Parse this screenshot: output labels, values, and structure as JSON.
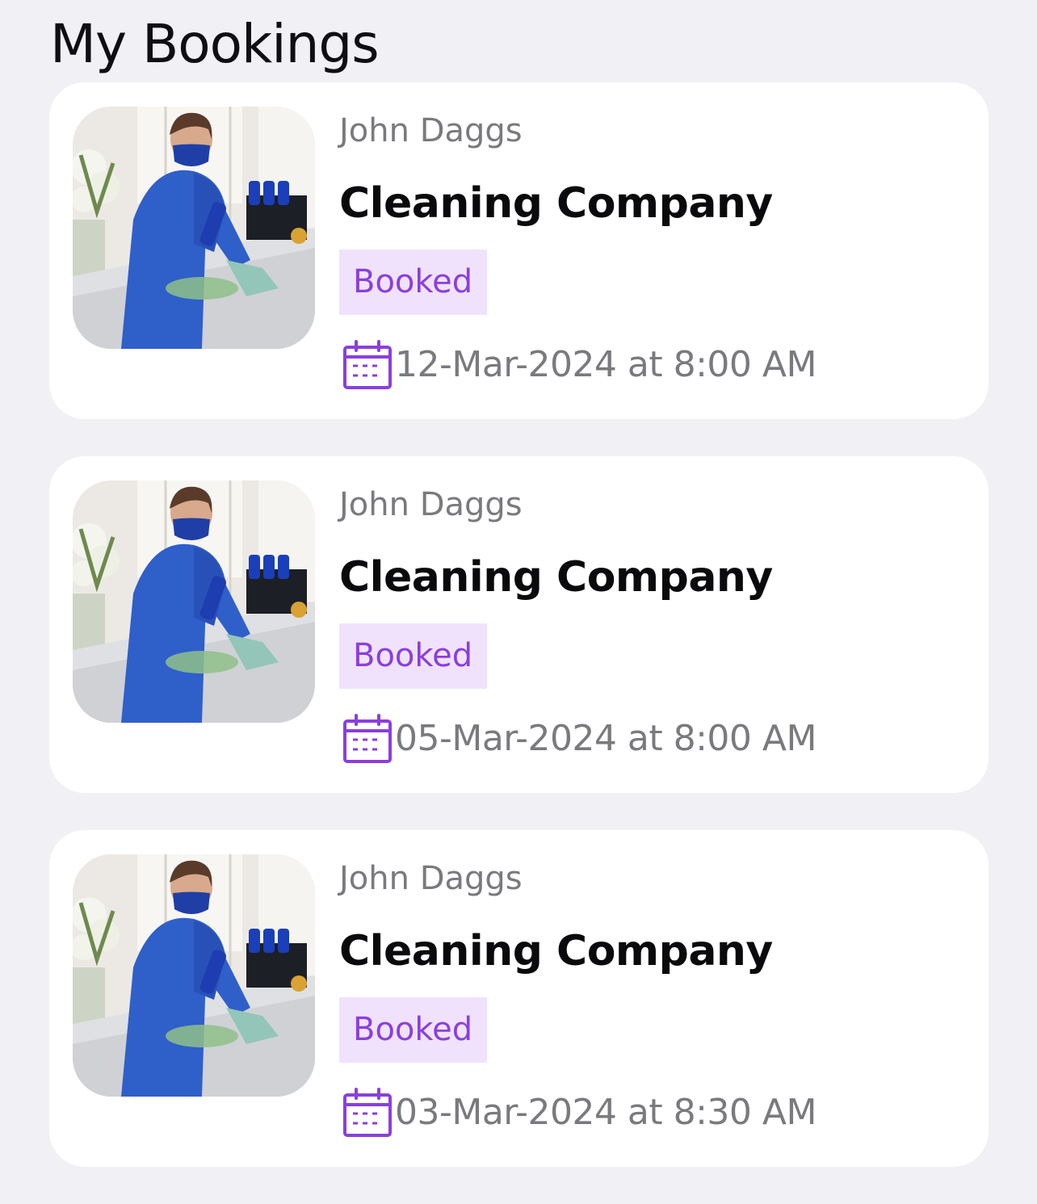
{
  "page": {
    "title": "My Bookings"
  },
  "bookings": [
    {
      "provider": "John Daggs",
      "service": "Cleaning Company",
      "status": "Booked",
      "datetime": "12-Mar-2024 at 8:00 AM",
      "image_icon": "cleaner-photo"
    },
    {
      "provider": "John Daggs",
      "service": "Cleaning Company",
      "status": "Booked",
      "datetime": "05-Mar-2024 at 8:00 AM",
      "image_icon": "cleaner-photo"
    },
    {
      "provider": "John Daggs",
      "service": "Cleaning Company",
      "status": "Booked",
      "datetime": "03-Mar-2024 at 8:30 AM",
      "image_icon": "cleaner-photo"
    }
  ],
  "colors": {
    "background": "#f1f0f4",
    "card": "#ffffff",
    "accent": "#8a3fde",
    "badge_bg": "#f0e2fd",
    "muted_text": "#7a7a7e"
  }
}
